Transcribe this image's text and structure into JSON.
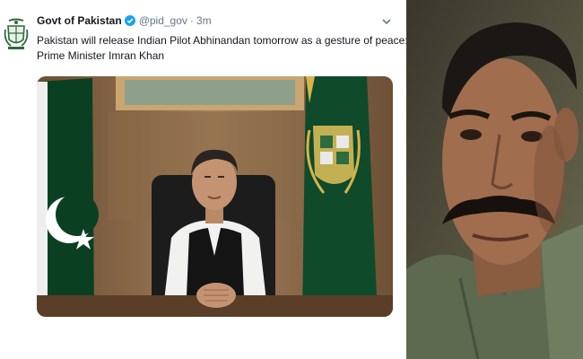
{
  "tweet": {
    "account_name": "Govt of Pakistan",
    "handle": "@pid_gov",
    "separator": "·",
    "time": "3m",
    "text_line1": "Pakistan will release Indian Pilot Abhinandan tomorrow as a gesture of peace:",
    "text_line2": "Prime Minister Imran Khan"
  },
  "icons": {
    "avatar": "state-emblem-icon",
    "verified": "verified-badge-icon",
    "menu": "chevron-down-icon"
  },
  "colors": {
    "verified_blue": "#1da1f2",
    "flag_green": "#0a3d22",
    "muted_text": "#657786"
  }
}
